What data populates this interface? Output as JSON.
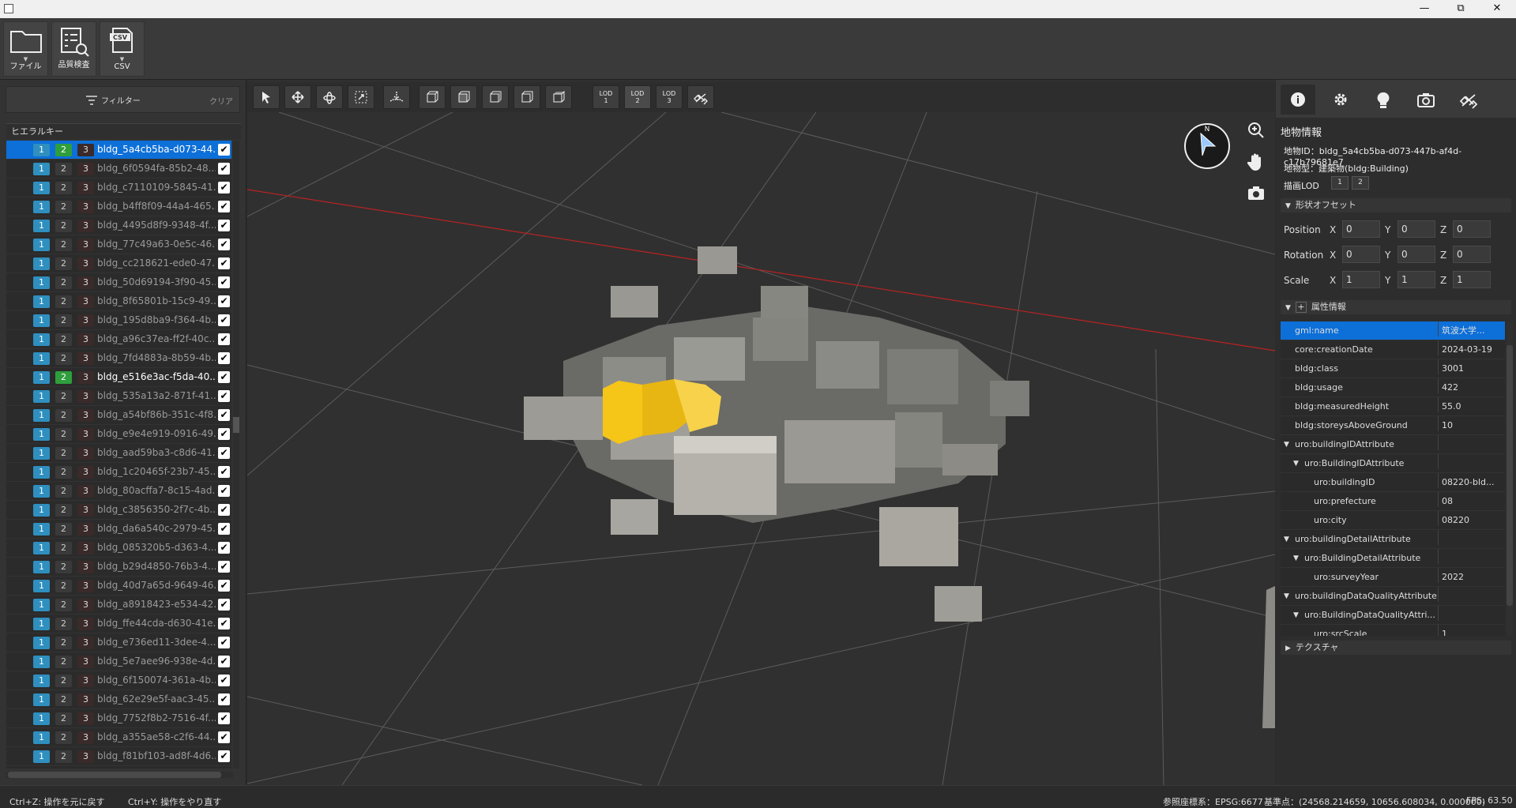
{
  "ribbon": {
    "file_label": "ファイル",
    "quality_label": "品質検査",
    "csv_label": "CSV",
    "csv_icon_text": "CSV"
  },
  "left": {
    "filter_label": "フィルター",
    "clear_label": "クリア",
    "hierarchy_title": "ヒエラルキー",
    "rows": [
      {
        "name": "bldg_5a4cb5ba-d073-44...",
        "lod2": true,
        "selected": true
      },
      {
        "name": "bldg_6f0594fa-85b2-48...",
        "lod2": false
      },
      {
        "name": "bldg_c7110109-5845-41...",
        "lod2": false
      },
      {
        "name": "bldg_b4ff8f09-44a4-465...",
        "lod2": false
      },
      {
        "name": "bldg_4495d8f9-9348-4f...",
        "lod2": false
      },
      {
        "name": "bldg_77c49a63-0e5c-46...",
        "lod2": false
      },
      {
        "name": "bldg_cc218621-ede0-47...",
        "lod2": false
      },
      {
        "name": "bldg_50d69194-3f90-45...",
        "lod2": false
      },
      {
        "name": "bldg_8f65801b-15c9-49...",
        "lod2": false
      },
      {
        "name": "bldg_195d8ba9-f364-4b...",
        "lod2": false
      },
      {
        "name": "bldg_a96c37ea-ff2f-40c...",
        "lod2": false
      },
      {
        "name": "bldg_7fd4883a-8b59-4b...",
        "lod2": false
      },
      {
        "name": "bldg_e516e3ac-f5da-40...",
        "lod2": true,
        "visible": true
      },
      {
        "name": "bldg_535a13a2-871f-41...",
        "lod2": false
      },
      {
        "name": "bldg_a54bf86b-351c-4f8...",
        "lod2": false
      },
      {
        "name": "bldg_e9e4e919-0916-49...",
        "lod2": false
      },
      {
        "name": "bldg_aad59ba3-c8d6-41...",
        "lod2": false
      },
      {
        "name": "bldg_1c20465f-23b7-45...",
        "lod2": false
      },
      {
        "name": "bldg_80acffa7-8c15-4ad...",
        "lod2": false
      },
      {
        "name": "bldg_c3856350-2f7c-4b...",
        "lod2": false
      },
      {
        "name": "bldg_da6a540c-2979-45...",
        "lod2": false
      },
      {
        "name": "bldg_085320b5-d363-4...",
        "lod2": false
      },
      {
        "name": "bldg_b29d4850-76b3-4...",
        "lod2": false
      },
      {
        "name": "bldg_40d7a65d-9649-46...",
        "lod2": false
      },
      {
        "name": "bldg_a8918423-e534-42...",
        "lod2": false
      },
      {
        "name": "bldg_ffe44cda-d630-41e...",
        "lod2": false
      },
      {
        "name": "bldg_e736ed11-3dee-4...",
        "lod2": false
      },
      {
        "name": "bldg_5e7aee96-938e-4d...",
        "lod2": false
      },
      {
        "name": "bldg_6f150074-361a-4b...",
        "lod2": false
      },
      {
        "name": "bldg_62e29e5f-aac3-45...",
        "lod2": false
      },
      {
        "name": "bldg_7752f8b2-7516-4f...",
        "lod2": false
      },
      {
        "name": "bldg_a355ae58-c2f6-44...",
        "lod2": false
      },
      {
        "name": "bldg_f81bf103-ad8f-4d6...",
        "lod2": false
      }
    ]
  },
  "toolbar": {
    "lod1": [
      "LOD",
      "1"
    ],
    "lod2": [
      "LOD",
      "2"
    ],
    "lod3": [
      "LOD",
      "3"
    ]
  },
  "viewport": {
    "compass_label": "N"
  },
  "right": {
    "section_title": "地物情報",
    "feature_id": "地物ID：bldg_5a4cb5ba-d073-447b-af4d-c17b79681e7",
    "feature_type": "地物型：建築物(bldg:Building)",
    "draw_lod_label": "描画LOD",
    "draw_lod_values": [
      "1",
      "2"
    ],
    "shape_offset_title": "形状オフセット",
    "position_label": "Position",
    "rotation_label": "Rotation",
    "scale_label": "Scale",
    "axis_x": "X",
    "axis_y": "Y",
    "axis_z": "Z",
    "position": [
      "0",
      "0",
      "0"
    ],
    "rotation": [
      "0",
      "0",
      "0"
    ],
    "scale": [
      "1",
      "1",
      "1"
    ],
    "attributes_title": "属性情報",
    "attributes_plus": "+",
    "attributes": [
      {
        "key": "gml:name",
        "value": "筑波大学...",
        "indent": 0,
        "selected": true
      },
      {
        "key": "core:creationDate",
        "value": "2024-03-19",
        "indent": 0
      },
      {
        "key": "bldg:class",
        "value": "3001",
        "indent": 0
      },
      {
        "key": "bldg:usage",
        "value": "422",
        "indent": 0
      },
      {
        "key": "bldg:measuredHeight",
        "value": "55.0",
        "indent": 0
      },
      {
        "key": "bldg:storeysAboveGround",
        "value": "10",
        "indent": 0
      },
      {
        "key": "uro:buildingIDAttribute",
        "value": "",
        "indent": 0,
        "expand": true
      },
      {
        "key": "uro:BuildingIDAttribute",
        "value": "",
        "indent": 1,
        "expand": true
      },
      {
        "key": "uro:buildingID",
        "value": "08220-bld...",
        "indent": 2
      },
      {
        "key": "uro:prefecture",
        "value": "08",
        "indent": 2
      },
      {
        "key": "uro:city",
        "value": "08220",
        "indent": 2
      },
      {
        "key": "uro:buildingDetailAttribute",
        "value": "",
        "indent": 0,
        "expand": true
      },
      {
        "key": "uro:BuildingDetailAttribute",
        "value": "",
        "indent": 1,
        "expand": true
      },
      {
        "key": "uro:surveyYear",
        "value": "2022",
        "indent": 2
      },
      {
        "key": "uro:buildingDataQualityAttribute",
        "value": "",
        "indent": 0,
        "expand": true
      },
      {
        "key": "uro:BuildingDataQualityAttri...",
        "value": "",
        "indent": 1,
        "expand": true
      },
      {
        "key": "uro:srcScale",
        "value": "1",
        "indent": 2
      }
    ],
    "texture_title": "テクスチャ"
  },
  "status": {
    "undo": "Ctrl+Z: 操作を元に戻す",
    "redo": "Ctrl+Y: 操作をやり直す",
    "crs": "参照座標系：EPSG:6677",
    "base": "基準点：(24568.214659, 10656.608034, 0.000000)",
    "fps": "FPS: 63.50"
  },
  "colors": {
    "selection": "#0d6fd8",
    "highlight_building": "#f5c518",
    "lod1": "#2f8fbf",
    "lod2_active": "#2f9e3c"
  }
}
